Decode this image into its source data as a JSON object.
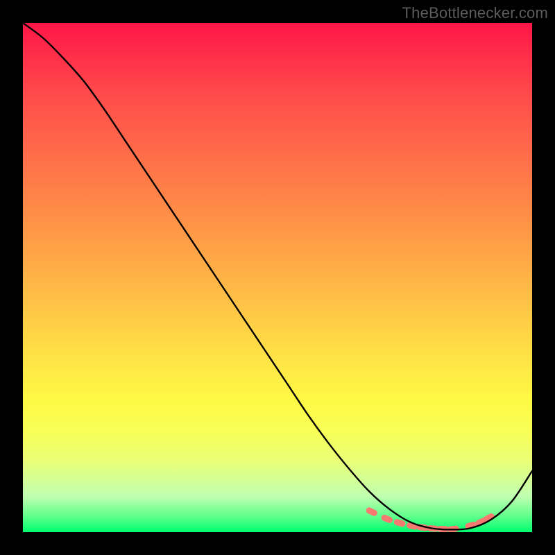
{
  "watermark": "TheBottlenecker.com",
  "colors": {
    "frame": "#000000",
    "curve": "#000000",
    "marker": "#f77a72"
  },
  "chart_data": {
    "type": "line",
    "title": "",
    "xlabel": "",
    "ylabel": "",
    "xlim": [
      0,
      100
    ],
    "ylim": [
      0,
      100
    ],
    "curve": {
      "x": [
        0,
        4,
        8,
        12,
        16,
        20,
        24,
        28,
        32,
        36,
        40,
        44,
        48,
        52,
        56,
        60,
        64,
        68,
        72,
        76,
        80,
        84,
        88,
        92,
        96,
        100
      ],
      "y": [
        100,
        97,
        93,
        88.5,
        83,
        77,
        71,
        65,
        59,
        53,
        47,
        41,
        35,
        29,
        23,
        17.5,
        12.5,
        8,
        4.5,
        2,
        0.8,
        0.5,
        0.8,
        2.5,
        6,
        12
      ]
    },
    "markers": {
      "x": [
        68.5,
        71.5,
        74,
        76.5,
        78.5,
        80.5,
        82.5,
        84.5,
        88,
        90,
        91.5
      ],
      "y": [
        4.0,
        2.6,
        1.8,
        1.2,
        0.9,
        0.7,
        0.6,
        0.6,
        1.3,
        2.0,
        2.8
      ]
    }
  }
}
